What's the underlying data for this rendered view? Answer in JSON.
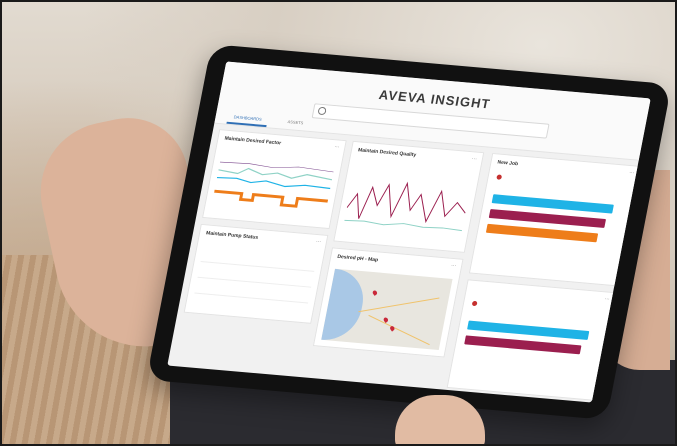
{
  "app": {
    "logo_text": "AVEVA INSIGHT",
    "accent": "#2f6fb5"
  },
  "tabs": [
    {
      "label": "DASHBOARDS",
      "active": true
    },
    {
      "label": "ASSETS",
      "active": false
    }
  ],
  "colors": {
    "cyan": "#1fb3e6",
    "maroon": "#9b1f4f",
    "orange": "#ee7d1a",
    "teal": "#8fd2c6",
    "purple": "#7e4c8f",
    "pin": "#c9283a"
  },
  "cards": {
    "c1": {
      "title": "Maintain Desired Factor"
    },
    "c2": {
      "title": "Maintain Desired Quality"
    },
    "c3": {
      "title": "New Job"
    },
    "c4": {
      "title": "Maintain Pump Status",
      "rows": [
        {
          "key": "",
          "value": ""
        },
        {
          "key": "",
          "value": ""
        },
        {
          "key": "",
          "value": ""
        }
      ]
    },
    "c5": {
      "title": "Desired pH - Map"
    },
    "c6": {
      "title": ""
    }
  }
}
